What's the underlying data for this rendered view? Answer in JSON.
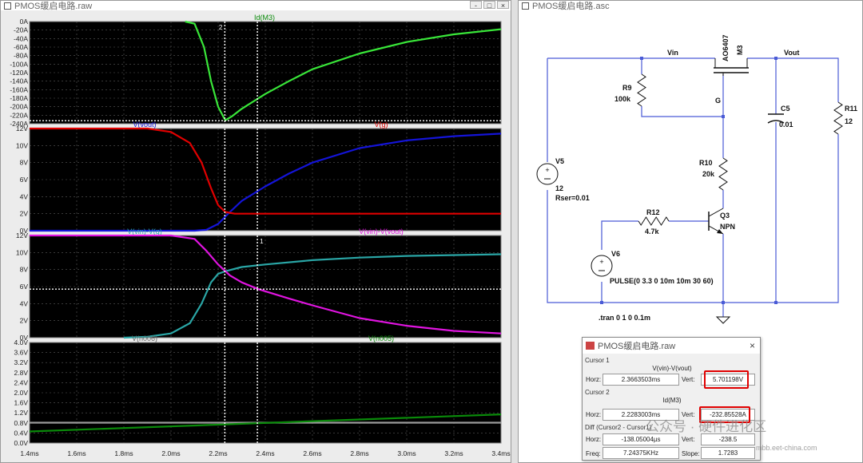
{
  "wave_window": {
    "title": "PMOS缓启电路.raw"
  },
  "sch_window": {
    "title": "PMOS缓启电路.asc"
  },
  "window_buttons": [
    "-",
    "□",
    "×"
  ],
  "colors": {
    "green": "#39e639",
    "red": "#e00000",
    "blue": "#1414d8",
    "teal": "#2aa6a6",
    "magenta": "#e014e0",
    "darkgreen": "#0a8a0a",
    "gray": "#9a9a9a",
    "plot_bg": "#000000",
    "grid": "#5a5a5a",
    "blue_wire": "#4a5bd6"
  },
  "x_axis": {
    "ticks": [
      "1.4ms",
      "1.6ms",
      "1.8ms",
      "2.0ms",
      "2.2ms",
      "2.4ms",
      "2.6ms",
      "2.8ms",
      "3.0ms",
      "3.2ms",
      "3.4ms"
    ]
  },
  "cursors": {
    "c1_ms": 2.3663503,
    "c2_ms": 2.2283003
  },
  "panes": [
    {
      "labels": [
        {
          "text": "Id(M3)",
          "color": "#0a8a0a"
        }
      ],
      "yticks": [
        "0A",
        "-20A",
        "-40A",
        "-60A",
        "-80A",
        "-100A",
        "-120A",
        "-140A",
        "-160A",
        "-180A",
        "-200A",
        "-220A",
        "-240A"
      ]
    },
    {
      "labels": [
        {
          "text": "V(vout)",
          "color": "#1414d8"
        },
        {
          "text": "V(g)",
          "color": "#e00000"
        }
      ],
      "yticks": [
        "12V",
        "10V",
        "8V",
        "6V",
        "4V",
        "2V",
        "0V"
      ]
    },
    {
      "labels": [
        {
          "text": "V(vin)-V(g)",
          "color": "#2aa6a6"
        },
        {
          "text": "V(vin)-V(vout)",
          "color": "#e014e0"
        }
      ],
      "yticks": [
        "12V",
        "10V",
        "8V",
        "6V",
        "4V",
        "2V",
        "0V"
      ]
    },
    {
      "labels": [
        {
          "text": "V(n006)",
          "color": "#606060"
        },
        {
          "text": "V(n005)",
          "color": "#0a8a0a"
        }
      ],
      "yticks": [
        "4.0V",
        "3.6V",
        "3.2V",
        "2.8V",
        "2.4V",
        "2.0V",
        "1.6V",
        "1.2V",
        "0.8V",
        "0.4V",
        "0.0V"
      ]
    }
  ],
  "chart_data": {
    "type": "line",
    "x_range_ms": [
      1.4,
      3.4
    ],
    "panes": [
      {
        "ylim": [
          -240,
          0
        ],
        "series": [
          {
            "name": "Id(M3)",
            "x": [
              2.06,
              2.1,
              2.14,
              2.17,
              2.2,
              2.23,
              2.26,
              2.3,
              2.4,
              2.5,
              2.6,
              2.8,
              3.0,
              3.2,
              3.4
            ],
            "y": [
              0,
              -5,
              -60,
              -140,
              -200,
              -232,
              -222,
              -205,
              -170,
              -140,
              -112,
              -75,
              -48,
              -30,
              -18
            ]
          }
        ]
      },
      {
        "ylim": [
          0,
          12
        ],
        "series": [
          {
            "name": "V(vout)",
            "x": [
              1.4,
              2.1,
              2.15,
              2.2,
              2.25,
              2.3,
              2.4,
              2.5,
              2.6,
              2.8,
              3.0,
              3.2,
              3.4
            ],
            "y": [
              0,
              0,
              0.1,
              0.8,
              2.2,
              3.5,
              5.2,
              6.7,
              8.0,
              9.7,
              10.6,
              11.1,
              11.4
            ]
          },
          {
            "name": "V(g)",
            "x": [
              1.4,
              1.9,
              2.0,
              2.08,
              2.13,
              2.17,
              2.2,
              2.23,
              2.27,
              2.3,
              3.4
            ],
            "y": [
              12,
              12,
              11.6,
              10.3,
              8.0,
              5.0,
              3.0,
              2.2,
              2.0,
              2.0,
              2.0
            ]
          }
        ]
      },
      {
        "ylim": [
          0,
          12
        ],
        "series": [
          {
            "name": "V(vin)-V(g)",
            "x": [
              1.8,
              1.9,
              2.0,
              2.08,
              2.13,
              2.17,
              2.2,
              2.23,
              2.3,
              2.4,
              2.6,
              2.8,
              3.0,
              3.4
            ],
            "y": [
              0,
              0.1,
              0.5,
              1.7,
              4.0,
              6.5,
              7.5,
              7.8,
              8.3,
              8.6,
              9.1,
              9.4,
              9.6,
              9.8
            ]
          },
          {
            "name": "V(vin)-V(vout)",
            "x": [
              1.4,
              2.0,
              2.1,
              2.15,
              2.2,
              2.25,
              2.3,
              2.37,
              2.5,
              2.6,
              2.8,
              3.0,
              3.2,
              3.4
            ],
            "y": [
              12,
              12,
              11.6,
              10.2,
              8.6,
              7.3,
              6.5,
              5.7,
              4.6,
              3.8,
              2.3,
              1.4,
              0.8,
              0.5
            ]
          }
        ]
      },
      {
        "ylim": [
          0,
          4
        ],
        "series": [
          {
            "name": "V(n006)",
            "x": [
              1.4,
              3.4
            ],
            "y": [
              0.81,
              0.81
            ]
          },
          {
            "name": "V(n005)",
            "x": [
              1.4,
              3.4
            ],
            "y": [
              0.46,
              1.14
            ]
          }
        ]
      }
    ]
  },
  "schematic": {
    "labels": {
      "vin": "Vin",
      "vout": "Vout",
      "m3_part": "AO6407",
      "m3_name": "M3",
      "g": "G",
      "r9": "R9",
      "r9_val": "100k",
      "c5": "C5",
      "c5_val": "0.01",
      "r11": "R11",
      "r11_val": "12",
      "v5": "V5",
      "v5_val": "12",
      "v5_rser": "Rser=0.01",
      "r10": "R10",
      "r10_val": "20k",
      "r12": "R12",
      "r12_val": "4.7k",
      "q3": "Q3",
      "q3_type": "NPN",
      "v6": "V6",
      "v6_val": "PULSE(0 3.3 0 10m 10m 30 60)",
      "tran": ".tran 0 1 0 0.1m"
    }
  },
  "cursor_dialog": {
    "title": "PMOS缓启电路.raw",
    "close": "×",
    "cursor1_label": "Cursor 1",
    "cursor1_trace": "V(vin)-V(vout)",
    "horz_label": "Horz:",
    "vert_label": "Vert:",
    "cursor1_horz": "2.3663503ms",
    "cursor1_vert": "5.701198V",
    "cursor2_label": "Cursor 2",
    "cursor2_trace": "Id(M3)",
    "cursor2_horz": "2.2283003ms",
    "cursor2_vert": "-232.85528A",
    "diff_label": "Diff (Cursor2 - Cursor1)",
    "diff_horz": "-138.05004µs",
    "diff_vert": "-238.5",
    "freq_label": "Freq:",
    "freq_value": "7.24375KHz",
    "slope_label": "Slope:",
    "slope_value": "1.7283"
  },
  "watermark": {
    "text": "公众号 · 硬件进化区",
    "sub": "mbb.eet-china.com"
  }
}
